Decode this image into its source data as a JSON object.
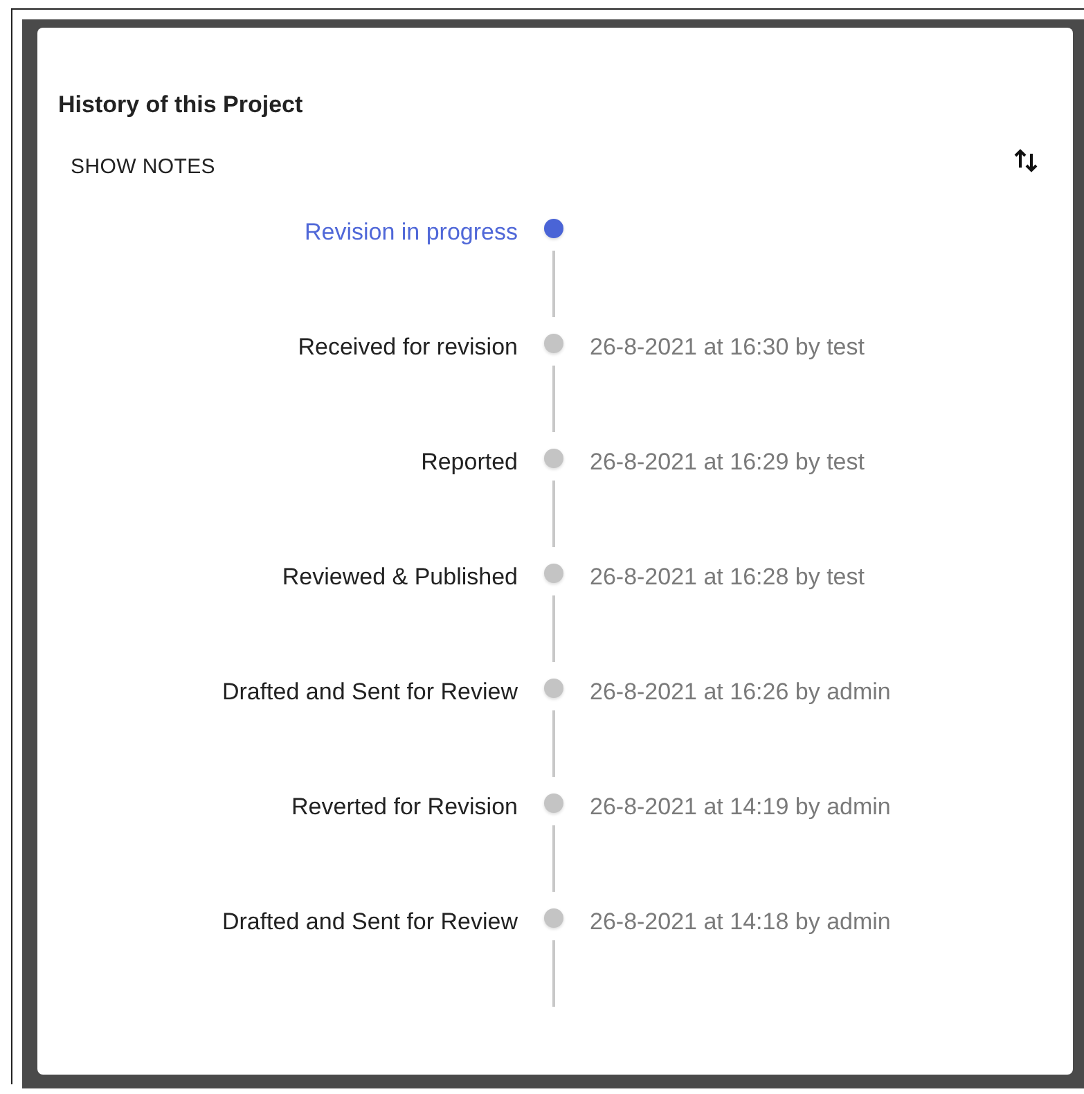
{
  "card": {
    "title": "History of this Project",
    "show_notes_button": "SHOW NOTES"
  },
  "timeline": [
    {
      "label": "Revision in progress",
      "selected": true
    },
    {
      "label": "Received for revision",
      "detail": "26-8-2021 at 16:30 by test",
      "selected": false
    },
    {
      "label": "Reported",
      "detail": "26-8-2021 at 16:29 by test",
      "selected": false
    },
    {
      "label": "Reviewed & Published",
      "detail": "26-8-2021 at 16:28 by test",
      "selected": false
    },
    {
      "label": "Drafted and Sent for Review",
      "detail": "26-8-2021 at 16:26 by admin",
      "selected": false
    },
    {
      "label": "Reverted for Revision",
      "detail": "26-8-2021 at 14:19 by admin",
      "selected": false
    },
    {
      "label": "Drafted and Sent for Review",
      "detail": "26-8-2021 at 14:18 by admin",
      "selected": false
    }
  ]
}
